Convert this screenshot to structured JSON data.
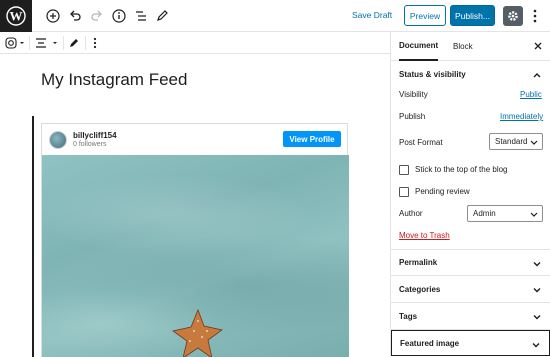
{
  "toolbar": {
    "save_draft": "Save Draft",
    "preview": "Preview",
    "publish": "Publish..."
  },
  "editor": {
    "title": "My Instagram Feed"
  },
  "instagram": {
    "username": "billycliff154",
    "followers": "0 followers",
    "view_profile": "View Profile"
  },
  "sidebar": {
    "tabs": [
      "Document",
      "Block"
    ],
    "status_visibility": {
      "heading": "Status & visibility",
      "visibility_label": "Visibility",
      "visibility_value": "Public",
      "publish_label": "Publish",
      "publish_value": "Immediately",
      "post_format_label": "Post Format",
      "post_format_value": "Standard",
      "stick_label": "Stick to the top of the blog",
      "pending_label": "Pending review",
      "author_label": "Author",
      "author_value": "Admin",
      "trash": "Move to Trash"
    },
    "panels": [
      "Permalink",
      "Categories",
      "Tags",
      "Featured image"
    ]
  },
  "colors": {
    "accent": "#0073aa",
    "instagram_button": "#0095f6",
    "trash": "#cc1818"
  }
}
